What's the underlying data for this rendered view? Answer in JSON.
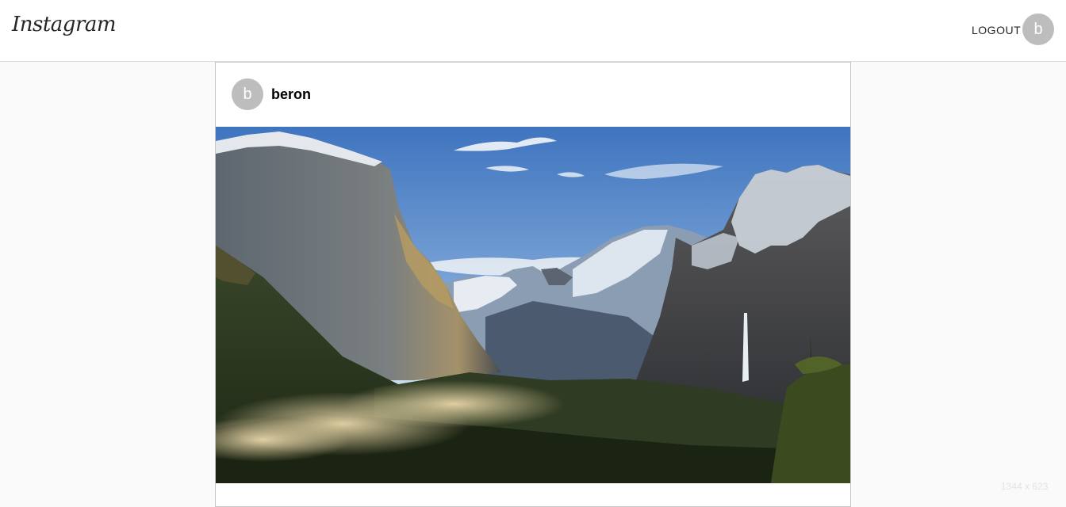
{
  "header": {
    "logo_text": "Instagram",
    "logout_label": "LOGOUT",
    "avatar_initial": "b"
  },
  "post": {
    "avatar_initial": "b",
    "username": "beron",
    "image_icon": "yosemite-valley-landscape-photo"
  },
  "watermark": {
    "dimensions_text": "1344 x 623"
  },
  "colors": {
    "avatar_bg": "#bdbdbd",
    "page_bg": "#fafafa",
    "header_bg": "#ffffff"
  }
}
